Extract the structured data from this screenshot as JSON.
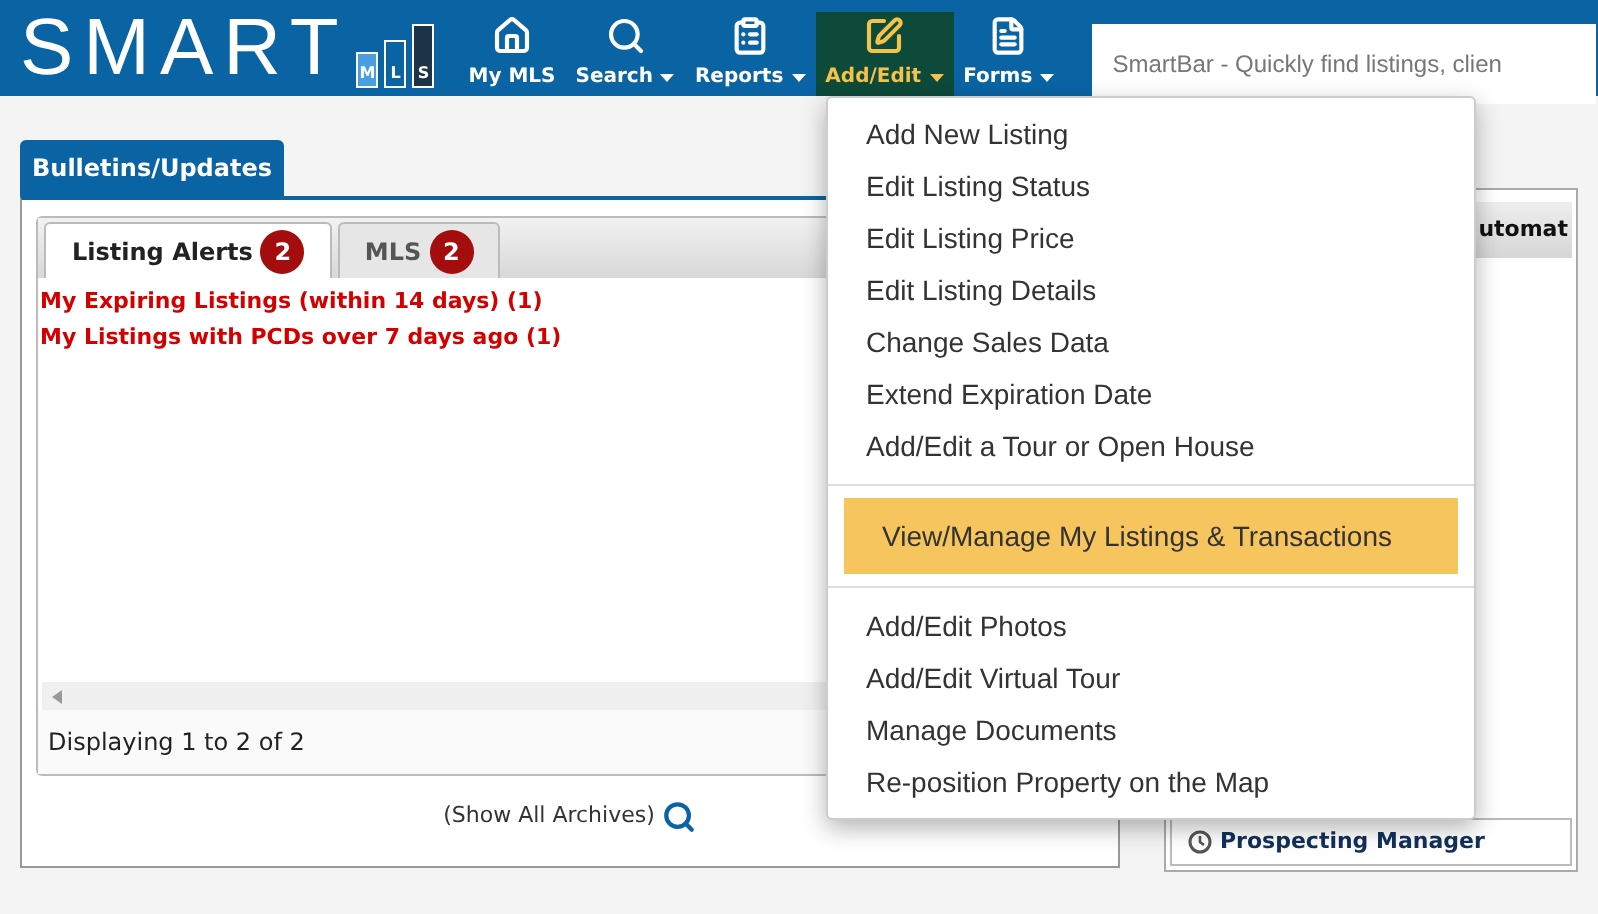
{
  "header": {
    "logo": {
      "word": "SMART",
      "letters": [
        "M",
        "L",
        "S"
      ]
    },
    "nav": [
      {
        "label": "My MLS",
        "kind": "home",
        "caret": false,
        "selected": false
      },
      {
        "label": "Search",
        "kind": "search",
        "caret": true,
        "selected": false
      },
      {
        "label": "Reports",
        "kind": "report",
        "caret": true,
        "selected": false
      },
      {
        "label": "Add/Edit",
        "kind": "edit",
        "caret": true,
        "selected": true
      },
      {
        "label": "Forms",
        "kind": "form",
        "caret": true,
        "selected": false
      }
    ],
    "smartbar": {
      "placeholder": "SmartBar - Quickly find listings, clien"
    }
  },
  "bulletins": {
    "title": "Bulletins/Updates",
    "tabs": [
      {
        "label": "Listing Alerts",
        "badge": "2",
        "selected": true
      },
      {
        "label": "MLS",
        "badge": "2",
        "selected": false
      }
    ],
    "alerts": [
      "My Expiring Listings (within 14 days) (1)",
      "My Listings with PCDs over 7 days ago (1)"
    ],
    "footer": "Displaying 1 to 2 of 2",
    "archives_link": "(Show All Archives)"
  },
  "side_panel": {
    "title": "utomat",
    "item": "Prospecting Manager"
  },
  "menu": {
    "groups": [
      {
        "highlighted": false,
        "items": [
          "Add New Listing",
          "Edit Listing Status",
          "Edit Listing Price",
          "Edit Listing Details",
          "Change Sales Data",
          "Extend Expiration Date",
          "Add/Edit a Tour or Open House"
        ]
      },
      {
        "highlighted": true,
        "items": [
          "View/Manage My Listings & Transactions"
        ]
      },
      {
        "highlighted": false,
        "items": [
          "Add/Edit Photos",
          "Add/Edit Virtual Tour",
          "Manage Documents",
          "Re-position Property on the Map"
        ]
      }
    ]
  }
}
